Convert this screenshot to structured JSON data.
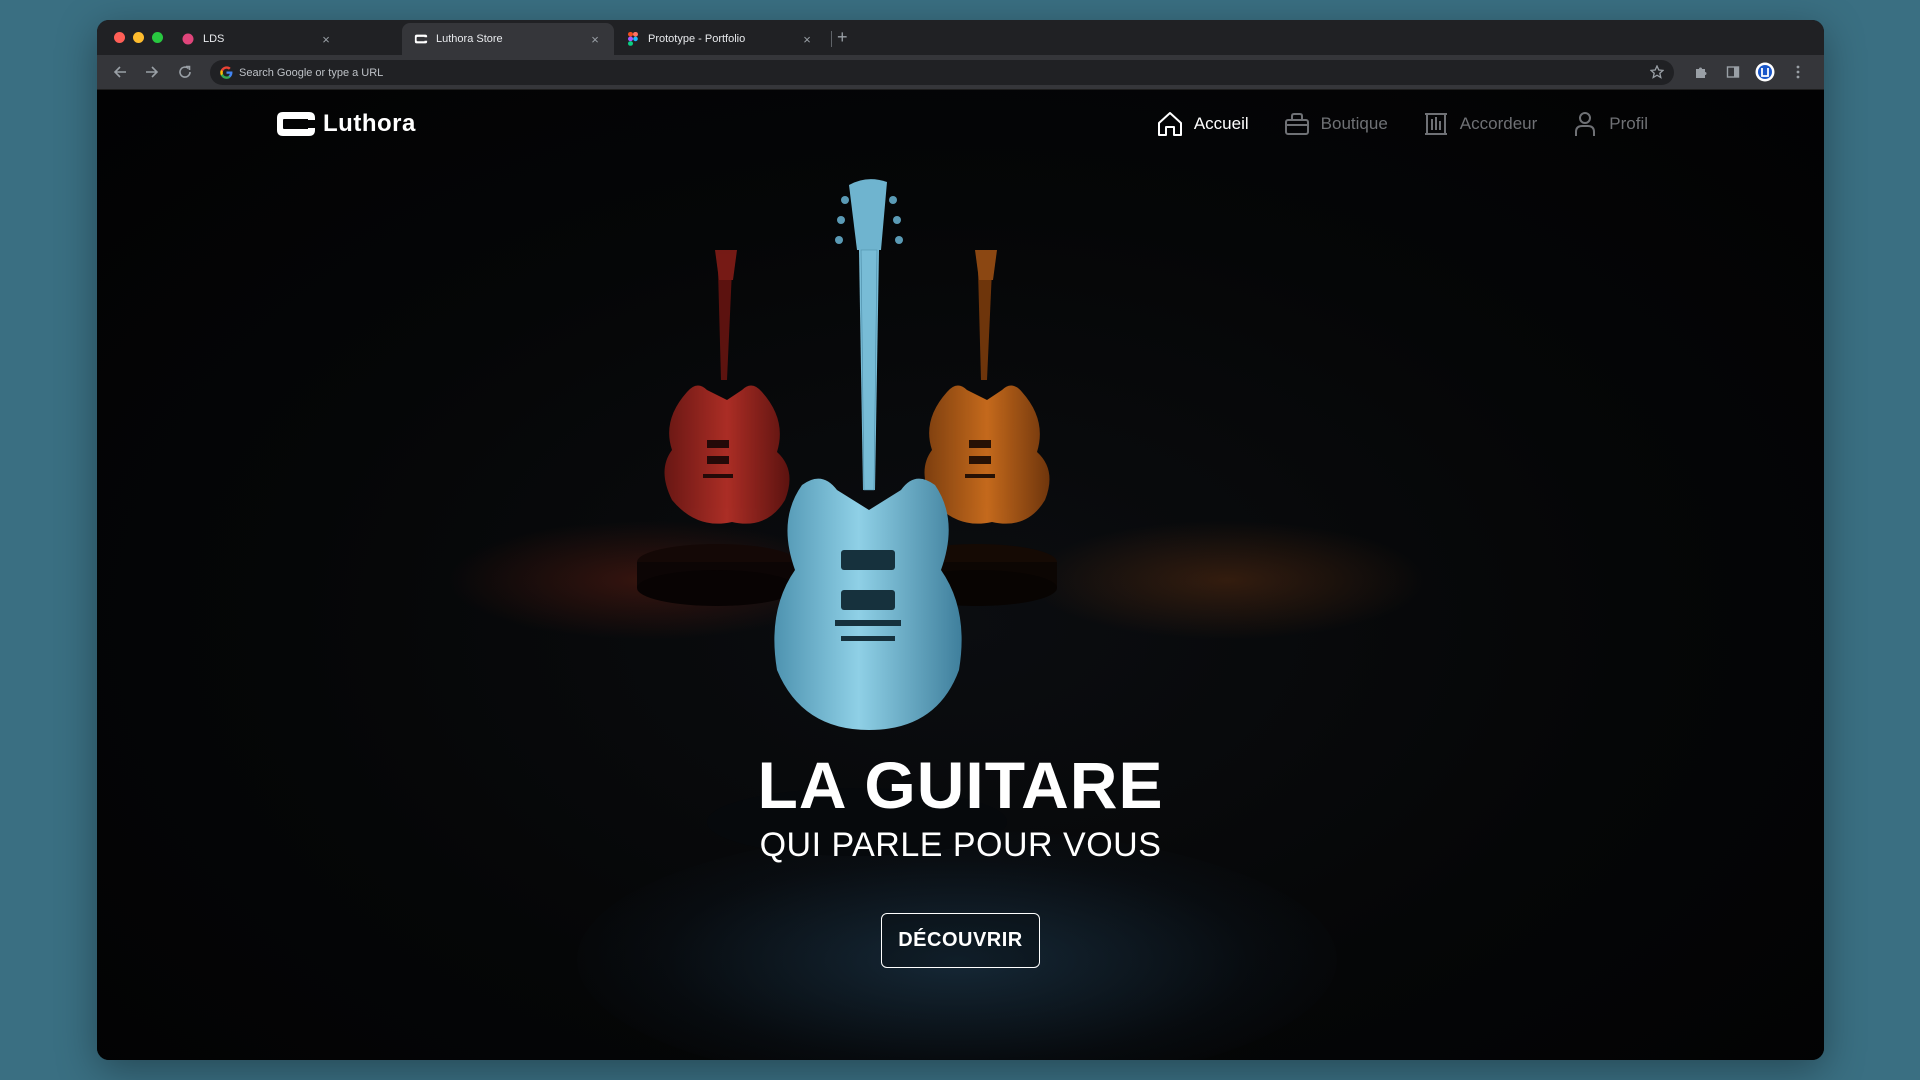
{
  "browser": {
    "tabs": [
      {
        "title": "LDS",
        "favicon": "lds-dot-icon"
      },
      {
        "title": "Luthora Store",
        "favicon": "luthora-logo-icon"
      },
      {
        "title": "Prototype - Portfolio",
        "favicon": "figma-icon"
      }
    ],
    "active_tab": 1,
    "omnibox_placeholder": "Search Google or type a URL",
    "colors": {
      "traffic_red": "#ff5f57",
      "traffic_yellow": "#febc2e",
      "traffic_green": "#28c840",
      "lds_favicon": "#e0457b"
    }
  },
  "site": {
    "brand": "Luthora",
    "nav": [
      {
        "label": "Accueil",
        "icon": "home-icon",
        "active": true
      },
      {
        "label": "Boutique",
        "icon": "shopping-bag-icon",
        "active": false
      },
      {
        "label": "Accordeur",
        "icon": "tuner-icon",
        "active": false
      },
      {
        "label": "Profil",
        "icon": "user-icon",
        "active": false
      }
    ],
    "hero": {
      "title": "LA GUITARE",
      "subtitle": "QUI PARLE POUR VOUS",
      "cta": "DÉCOUVRIR"
    },
    "guitar_colors": {
      "red": "#c8342a",
      "blue": "#7ec4dc",
      "orange": "#d9741e"
    }
  }
}
